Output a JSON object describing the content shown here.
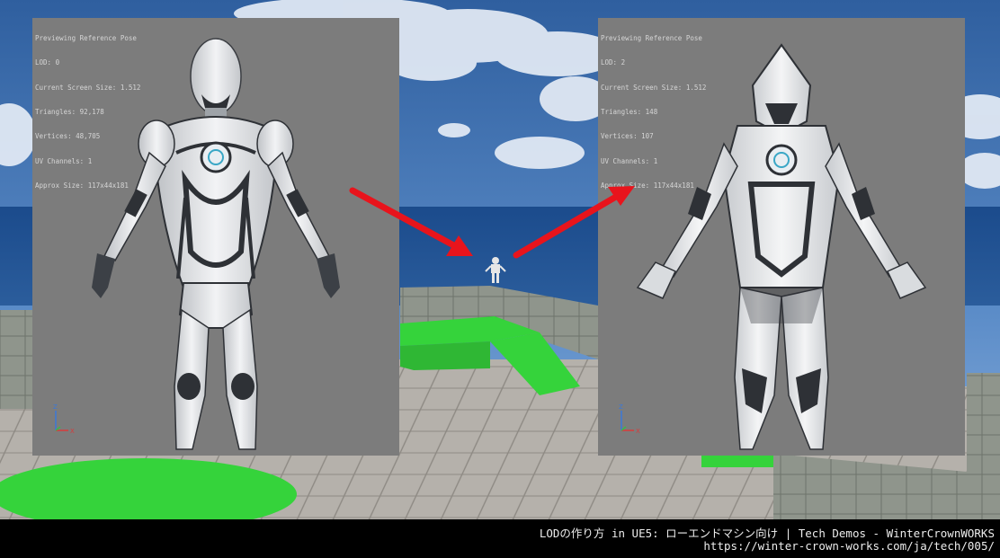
{
  "panels": {
    "left": {
      "stats": [
        "Previewing Reference Pose",
        "LOD: 0",
        "Current Screen Size: 1.512",
        "Triangles: 92,178",
        "Vertices: 48,705",
        "UV Channels: 1",
        "Approx Size: 117x44x181"
      ],
      "axis": {
        "z": "Z",
        "x": "X"
      }
    },
    "right": {
      "stats": [
        "Previewing Reference Pose",
        "LOD: 2",
        "Current Screen Size: 1.512",
        "Triangles: 148",
        "Vertices: 107",
        "UV Channels: 1",
        "Approx Size: 117x44x181"
      ],
      "axis": {
        "z": "Z",
        "x": "X"
      }
    }
  },
  "caption": {
    "title": "LODの作り方 in UE5: ローエンドマシン向け | Tech Demos - WinterCrownWORKS",
    "url": "https://winter-crown-works.com/ja/tech/005/"
  },
  "colors": {
    "arrow": "#e8141c",
    "panel_bg": "#7c7c7c",
    "green_block": "#35d33b",
    "sky": "#3f6fb0"
  }
}
